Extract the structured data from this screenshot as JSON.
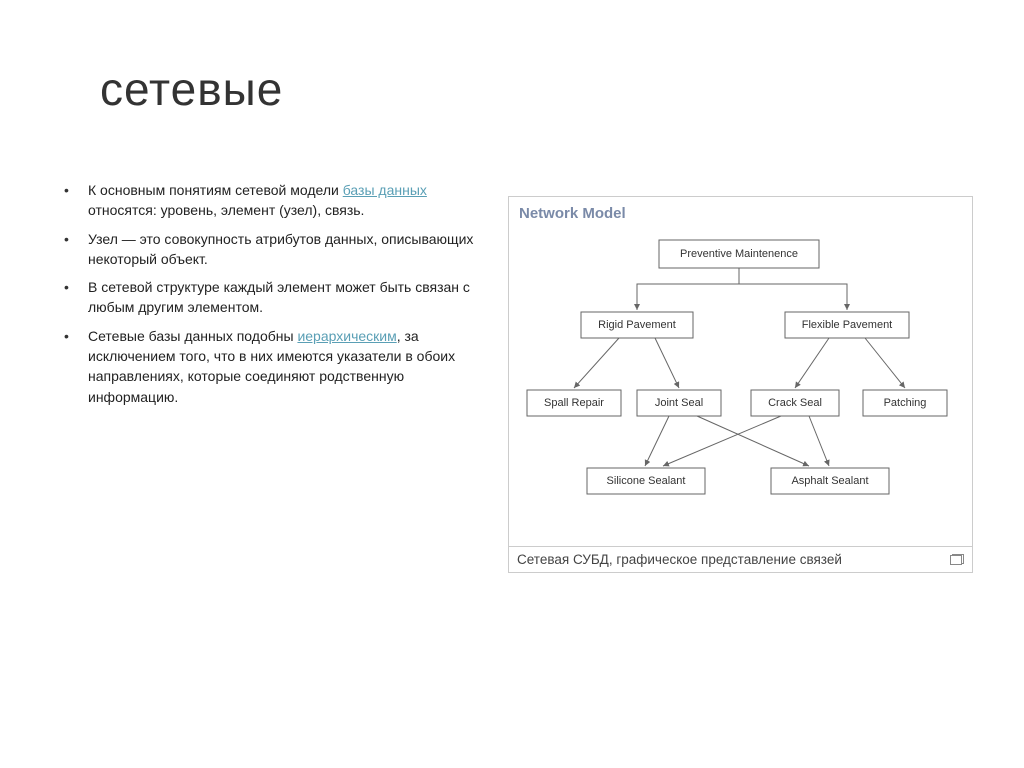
{
  "title": "сетевые",
  "bullets": [
    {
      "pre": "К основным понятиям сетевой модели ",
      "link": "базы данных",
      "post": " относятся: уровень, элемент (узел), связь."
    },
    {
      "pre": "Узел — это совокупность атрибутов данных, описывающих некоторый объект.",
      "link": "",
      "post": ""
    },
    {
      "pre": "В сетевой структуре каждый элемент может быть связан с любым другим элементом.",
      "link": "",
      "post": ""
    },
    {
      "pre": "Сетевые базы данных подобны ",
      "link": "иерархическим",
      "post": ", за исключением того, что в них имеются указатели в обоих направлениях, которые соединяют родственную информацию."
    }
  ],
  "diagram": {
    "heading": "Network Model",
    "caption": "Сетевая СУБД, графическое представление связей",
    "nodes": {
      "root": "Preventive Maintenence",
      "left1": "Rigid Pavement",
      "right1": "Flexible Pavement",
      "l2a": "Spall Repair",
      "l2b": "Joint Seal",
      "l2c": "Crack Seal",
      "l2d": "Patching",
      "l3a": "Silicone Sealant",
      "l3b": "Asphalt Sealant"
    }
  }
}
